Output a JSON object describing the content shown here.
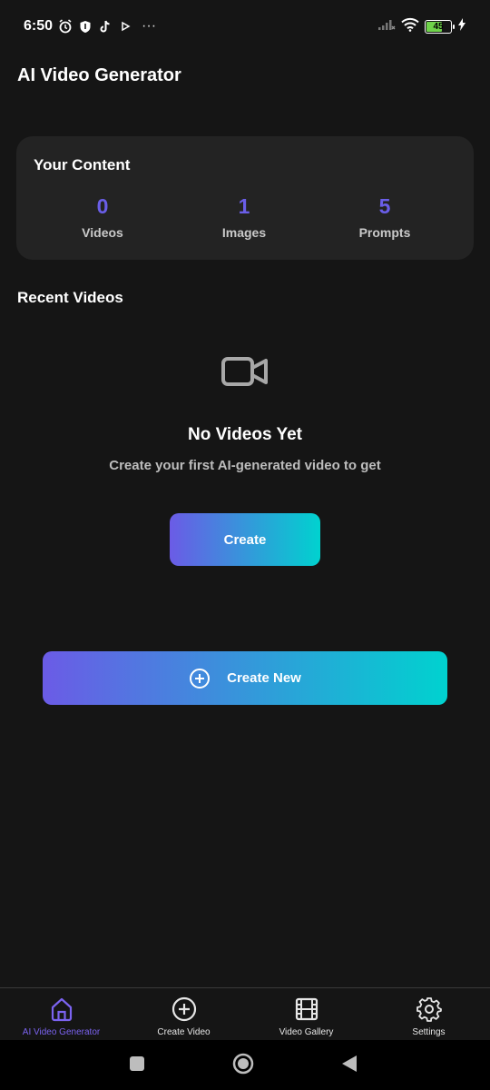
{
  "status_bar": {
    "time": "6:50",
    "battery_level": "45",
    "icons": [
      "alarm-icon",
      "shield-icon",
      "tiktok-icon",
      "play-icon",
      "more-icon",
      "signal-icon",
      "wifi-icon",
      "battery-icon",
      "charging-icon"
    ],
    "more": "···"
  },
  "app": {
    "title": "AI Video Generator"
  },
  "your_content": {
    "title": "Your Content",
    "stats": [
      {
        "value": "0",
        "label": "Videos"
      },
      {
        "value": "1",
        "label": "Images"
      },
      {
        "value": "5",
        "label": "Prompts"
      }
    ]
  },
  "recent_videos": {
    "title": "Recent Videos",
    "empty_icon": "video-camera-icon",
    "empty_title": "No Videos Yet",
    "empty_subtitle": "Create your first AI-generated video to get",
    "create_label": "Create"
  },
  "create_new": {
    "label": "Create New",
    "icon": "plus-circle-icon"
  },
  "bottom_nav": {
    "items": [
      {
        "label": "AI Video Generator",
        "icon": "home-icon",
        "active": true
      },
      {
        "label": "Create Video",
        "icon": "plus-circle-icon",
        "active": false
      },
      {
        "label": "Video Gallery",
        "icon": "film-icon",
        "active": false
      },
      {
        "label": "Settings",
        "icon": "gear-icon",
        "active": false
      }
    ]
  },
  "colors": {
    "background": "#151515",
    "card": "#232323",
    "accent": "#6a5ee8",
    "gradient_start": "#6b5be6",
    "gradient_end": "#00d2cf"
  }
}
